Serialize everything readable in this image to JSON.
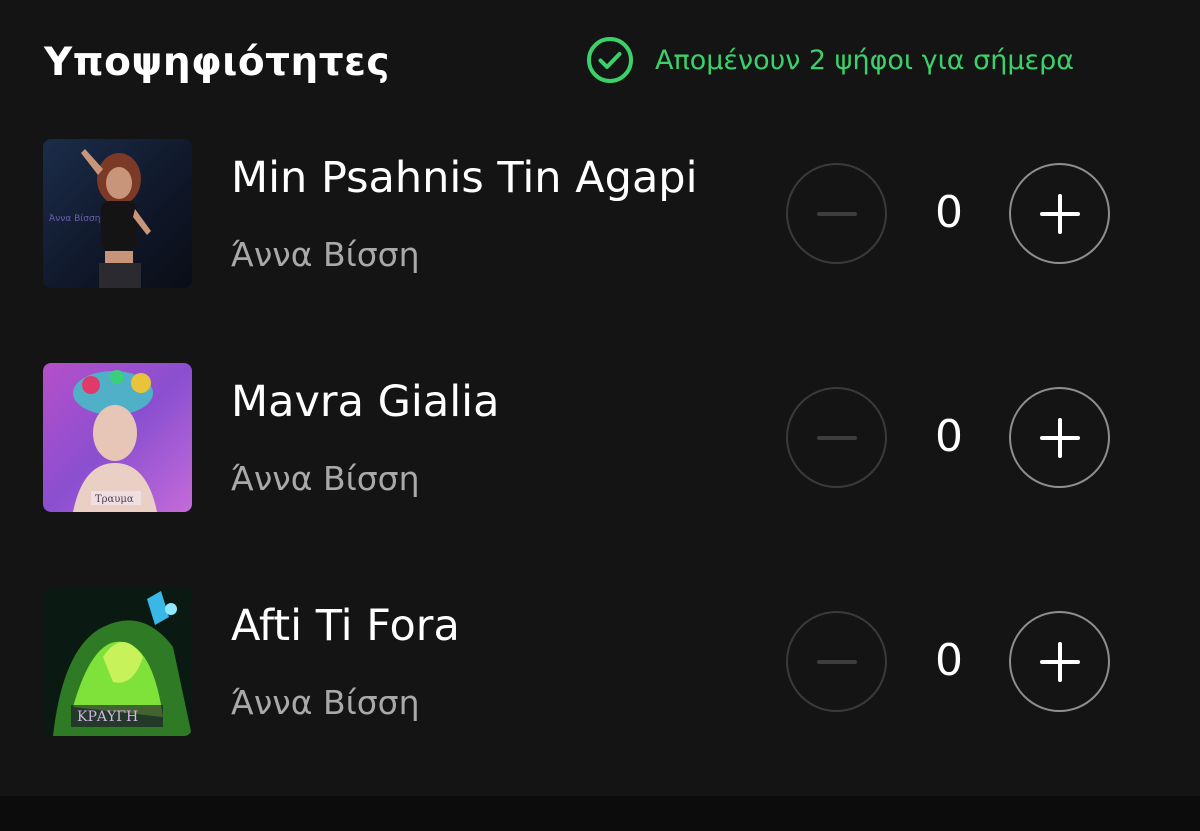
{
  "header": {
    "title": "Υποψηφιότητες",
    "votes_remaining_text": "Απομένουν 2 ψήφοι για σήμερα",
    "votes_icon": "check-circle-icon"
  },
  "colors": {
    "accent_green": "#3bd16a",
    "background": "#141414",
    "secondary_text": "#a9a9a9"
  },
  "candidates": [
    {
      "title": "Min Psahnis Tin Agapi",
      "artist": "Άννα Βίσση",
      "count": "0",
      "cover_label": "Άννα Βίσση"
    },
    {
      "title": "Mavra Gialia",
      "artist": "Άννα Βίσση",
      "count": "0",
      "cover_label": "Τραυμα"
    },
    {
      "title": "Afti Ti Fora",
      "artist": "Άννα Βίσση",
      "count": "0",
      "cover_label": "ΚΡΑΥΓΗ"
    }
  ],
  "controls": {
    "decrement_icon": "minus-icon",
    "increment_icon": "plus-icon"
  }
}
